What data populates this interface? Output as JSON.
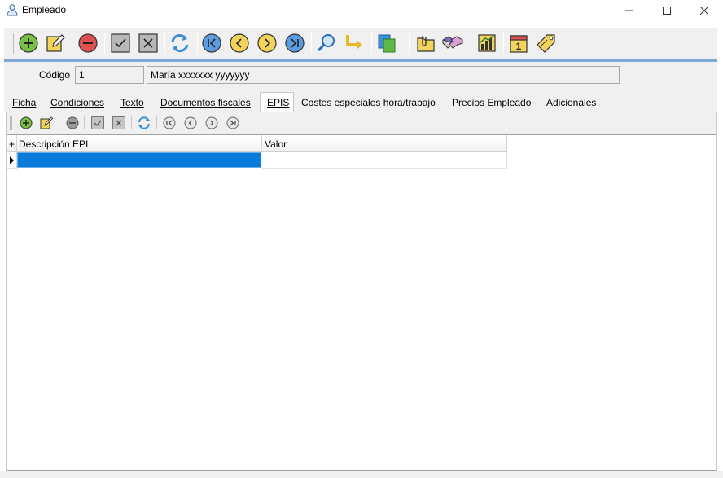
{
  "window": {
    "title": "Empleado",
    "title_icon": "user-icon",
    "controls": [
      "minimize-icon",
      "maximize-icon",
      "close-icon"
    ]
  },
  "toolbar": {
    "buttons": [
      {
        "name": "add-button",
        "icon": "plus-circle-icon",
        "color": "#7ac143"
      },
      {
        "name": "edit-button",
        "icon": "edit-icon",
        "color": "#f2d45c"
      },
      {
        "name": "delete-button",
        "icon": "minus-circle-icon",
        "color": "#e05050"
      },
      {
        "name": "accept-button",
        "icon": "check-icon"
      },
      {
        "name": "cancel-button",
        "icon": "x-icon"
      },
      {
        "name": "refresh-button",
        "icon": "refresh-icon",
        "color": "#3a8fd8"
      },
      {
        "name": "first-button",
        "icon": "first-icon",
        "color": "#4a90d9"
      },
      {
        "name": "previous-button",
        "icon": "previous-icon",
        "color": "#f2d45c"
      },
      {
        "name": "next-button",
        "icon": "next-icon",
        "color": "#f2d45c"
      },
      {
        "name": "last-button",
        "icon": "last-icon",
        "color": "#4a90d9"
      },
      {
        "name": "search-button",
        "icon": "search-icon"
      },
      {
        "name": "goto-button",
        "icon": "arrow-turn-icon"
      },
      {
        "name": "copy-button",
        "icon": "copy-icon"
      },
      {
        "name": "attachments-button",
        "icon": "folder-clip-icon"
      },
      {
        "name": "agreement-button",
        "icon": "handshake-icon"
      },
      {
        "name": "statistics-button",
        "icon": "chart-icon"
      },
      {
        "name": "calendar-button",
        "icon": "calendar-icon",
        "calendar_day": "1"
      },
      {
        "name": "price-tag-button",
        "icon": "tag-icon"
      }
    ]
  },
  "header": {
    "codigo_label": "Código",
    "codigo_value": "1",
    "name_value": "María xxxxxxx yyyyyyy"
  },
  "tabs": [
    {
      "label": "Ficha",
      "active": false
    },
    {
      "label": "Condiciones",
      "active": false
    },
    {
      "label": "Texto",
      "active": false
    },
    {
      "label": "Documentos fiscales",
      "active": false
    },
    {
      "label": "EPIS",
      "active": true
    },
    {
      "label": "Costes especiales hora/trabajo",
      "active": false
    },
    {
      "label": "Precios Empleado",
      "active": false
    },
    {
      "label": "Adicionales",
      "active": false
    }
  ],
  "grid": {
    "corner": "+",
    "columns": [
      "Descripción EPI",
      "Valor"
    ],
    "rows": [
      [
        "",
        ""
      ]
    ],
    "selection_color": "#0a7bd8"
  }
}
